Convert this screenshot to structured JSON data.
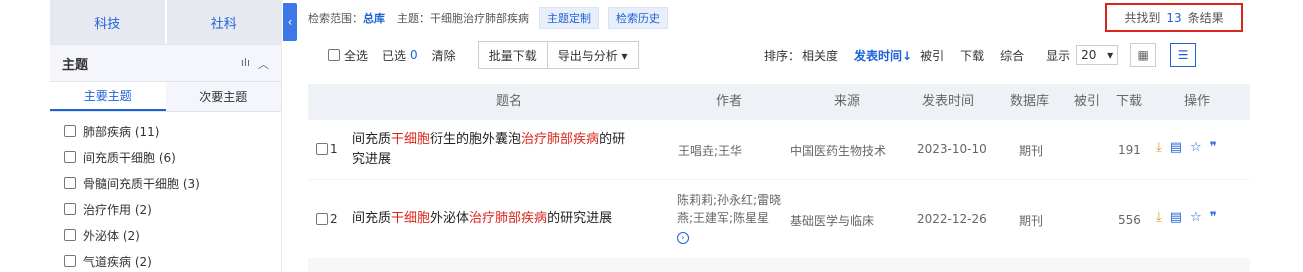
{
  "sidebar": {
    "categories": [
      "科技",
      "社科"
    ],
    "section_title": "主题",
    "sub_tabs": [
      "主要主题",
      "次要主题"
    ],
    "topics": [
      "肺部疾病 (11)",
      "间充质干细胞 (6)",
      "骨髓间充质干细胞 (3)",
      "治疗作用 (2)",
      "外泌体 (2)",
      "气道疾病 (2)"
    ]
  },
  "collapse_icon": "‹",
  "search_info": {
    "scope_label": "检索范围：",
    "scope_value": "总库",
    "subject_label": "主题：",
    "subject_value": "干细胞治疗肺部疾病",
    "btn_custom": "主题定制",
    "btn_history": "检索历史"
  },
  "results": {
    "prefix": "共找到",
    "count": "13",
    "suffix": "条结果"
  },
  "toolbar": {
    "select_all": "全选",
    "selected_label": "已选",
    "selected_count": "0",
    "clear": "清除",
    "batch_download": "批量下载",
    "export": "导出与分析 ▾",
    "sort_label": "排序：",
    "sort_options": [
      "相关度",
      "发表时间↓",
      "被引",
      "下载",
      "综合"
    ],
    "display_label": "显示",
    "page_size": "20",
    "grid_icon": "▦",
    "list_icon": "☰"
  },
  "table": {
    "headers": [
      "题名",
      "作者",
      "来源",
      "发表时间",
      "数据库",
      "被引",
      "下载",
      "操作"
    ],
    "rows": [
      {
        "index": "1",
        "title_parts": [
          "间充质",
          "干细胞",
          "衍生的胞外囊泡",
          "治疗肺部疾病",
          "的研"
        ],
        "title_line2": "究进展",
        "authors": "王唱垚;王华",
        "authors2": "",
        "source": "中国医药生物技术",
        "date": "2023-10-10",
        "db": "期刊",
        "cited": "",
        "downloads": "191"
      },
      {
        "index": "2",
        "title_parts": [
          "间充质",
          "干细胞",
          "外泌体",
          "治疗肺部疾病",
          "的研究进展"
        ],
        "title_line2": "",
        "authors": "陈莉莉;孙永红;雷晓",
        "authors2": "燕;王建军;陈星星",
        "source": "基础医学与临床",
        "date": "2022-12-26",
        "db": "期刊",
        "cited": "",
        "downloads": "556"
      }
    ]
  },
  "op_icons": [
    "⤓",
    "▤",
    "☆",
    "❞"
  ]
}
